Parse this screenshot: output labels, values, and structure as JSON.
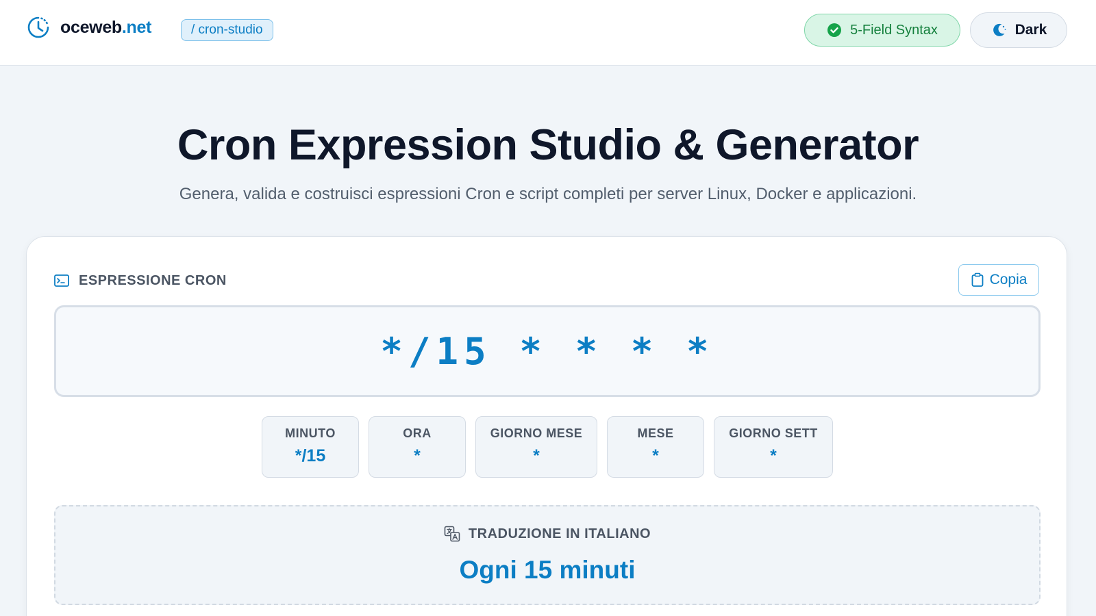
{
  "header": {
    "logo": {
      "name": "oceweb",
      "tld": ".net",
      "icon": "clock-icon"
    },
    "path": "/ cron-studio",
    "syntax_badge": {
      "label": "5-Field Syntax",
      "icon": "check-circle-icon"
    },
    "theme_button": {
      "label": "Dark",
      "icon": "moon-icon"
    }
  },
  "hero": {
    "title": "Cron Expression Studio & Generator",
    "subtitle": "Genera, valida e costruisci espressioni Cron e script completi per server Linux, Docker e applicazioni."
  },
  "expression_card": {
    "section_label": "ESPRESSIONE CRON",
    "section_icon": "terminal-icon",
    "copy_button": {
      "label": "Copia",
      "icon": "clipboard-icon"
    },
    "expression": "*/15 * * * *",
    "fields": [
      {
        "label": "MINUTO",
        "value": "*/15"
      },
      {
        "label": "ORA",
        "value": "*"
      },
      {
        "label": "GIORNO MESE",
        "value": "*"
      },
      {
        "label": "MESE",
        "value": "*"
      },
      {
        "label": "GIORNO SETT",
        "value": "*"
      }
    ],
    "translation": {
      "label": "TRADUZIONE IN ITALIANO",
      "icon": "translate-icon",
      "text": "Ogni 15 minuti"
    }
  },
  "colors": {
    "accent": "#0c7ec4",
    "success": "#15803d",
    "background": "#f1f5f9",
    "text": "#0f172a"
  }
}
